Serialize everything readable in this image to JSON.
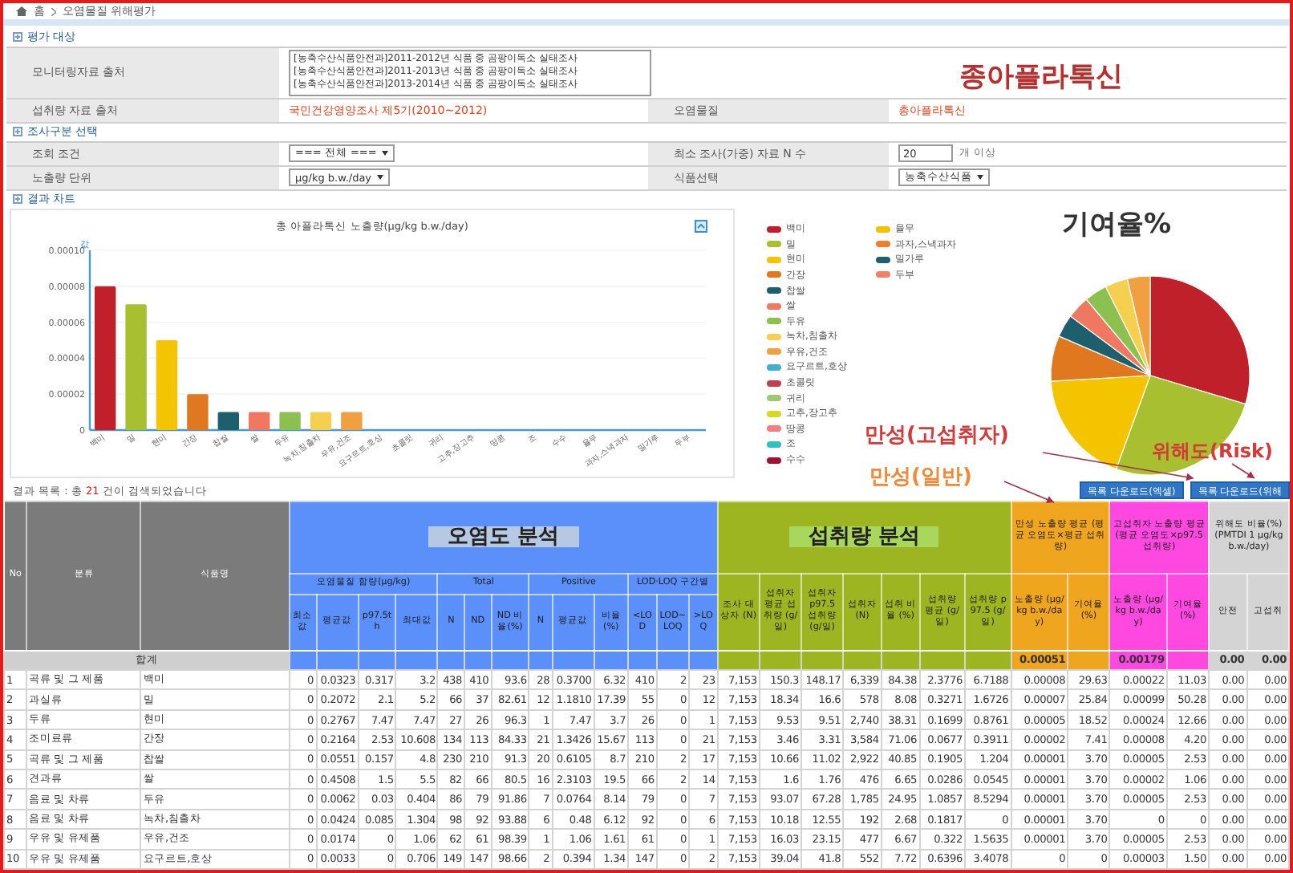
{
  "breadcrumb": {
    "items": [
      "홈",
      "오염물질 위해평가"
    ]
  },
  "evaluation_target": {
    "title": "평가 대상",
    "monitoring_source": {
      "label": "모니터링자료 출처",
      "options": [
        "[농축수산식품안전과]2011-2012년 식품 중 곰팡이독소 실태조사",
        "[농축수산식품안전과]2011-2013년 식품 중 곰팡이독소 실태조사",
        "[농축수산식품안전과]2013-2014년 식품 중 곰팡이독소 실태조사"
      ]
    },
    "intake_source": {
      "label": "섭취량 자료 출처",
      "value": "국민건강영양조사 제5기(2010~2012)"
    },
    "contaminant": {
      "label": "오염물질",
      "value": "총아플라톡신"
    }
  },
  "survey_filter": {
    "title": "조사구분 선택",
    "fields": [
      {
        "label": "조회 조건",
        "kind": "select",
        "value": "=== 전체 ==="
      },
      {
        "label": "최소 조사(가중) 자료 N 수",
        "kind": "number",
        "value": "20",
        "suffix": "개 이상"
      },
      {
        "label": "노출량 단위",
        "kind": "select",
        "value": "μg/kg b.w./day"
      },
      {
        "label": "식품선택",
        "kind": "select",
        "value": "농축수산식품"
      }
    ]
  },
  "results_chart": {
    "title": "결과 차트",
    "chart_data": {
      "type": "bar",
      "title": "총 아플라톡신 노출량(μg/kg b.w./day)",
      "ylabel": "값",
      "categories": [
        "백미",
        "밀",
        "현미",
        "간장",
        "찹쌀",
        "쌀",
        "두유",
        "녹차,침출차",
        "우유,건조",
        "요구르트,호상",
        "초콜릿",
        "귀리",
        "고추,장고추",
        "땅콩",
        "조",
        "수수",
        "율무",
        "과자,스낵과자",
        "밀가루",
        "두부"
      ],
      "values": [
        8e-05,
        7e-05,
        5e-05,
        2e-05,
        1e-05,
        1e-05,
        1e-05,
        1e-05,
        1e-05,
        0,
        0,
        0,
        0,
        0,
        0,
        0,
        0,
        0,
        0,
        0
      ],
      "grid": true,
      "ylim": [
        0,
        0.0001
      ],
      "yticks": [
        {
          "value": 0,
          "label": "0"
        },
        {
          "value": 2e-05,
          "label": "0.00002"
        },
        {
          "value": 4e-05,
          "label": "0.00004"
        },
        {
          "value": 6e-05,
          "label": "0.00006"
        },
        {
          "value": 8e-05,
          "label": "0.00008"
        },
        {
          "value": 0.0001,
          "label": "0.00010"
        }
      ]
    },
    "legend": [
      {
        "label": "백미",
        "color": "#c0202a"
      },
      {
        "label": "밀",
        "color": "#a8c030"
      },
      {
        "label": "현미",
        "color": "#f5c400"
      },
      {
        "label": "간장",
        "color": "#e07820"
      },
      {
        "label": "찹쌀",
        "color": "#1e5f6e"
      },
      {
        "label": "쌀",
        "color": "#f07860"
      },
      {
        "label": "두유",
        "color": "#8cc050"
      },
      {
        "label": "녹차,침출차",
        "color": "#f5d050"
      },
      {
        "label": "우유,건조",
        "color": "#f0a040"
      },
      {
        "label": "요구르트,호상",
        "color": "#40b0d0"
      },
      {
        "label": "초콜릿",
        "color": "#c04050"
      },
      {
        "label": "귀리",
        "color": "#a0c870"
      },
      {
        "label": "고추,장고추",
        "color": "#d8d820"
      },
      {
        "label": "땅콩",
        "color": "#f08080"
      },
      {
        "label": "조",
        "color": "#30c0c0"
      },
      {
        "label": "수수",
        "color": "#a01030"
      },
      {
        "label": "율무",
        "color": "#f2c200"
      },
      {
        "label": "과자,스낵과자",
        "color": "#e88030"
      },
      {
        "label": "밀가루",
        "color": "#1e6070"
      },
      {
        "label": "두부",
        "color": "#f08068"
      }
    ]
  },
  "annotations": {
    "contaminant_title": "종아플라톡신",
    "contribution_title": "기여율%",
    "chronic_high": "만성(고섭취자)",
    "chronic_general": "만성(일반)",
    "risk": "위해도(Risk)"
  },
  "results_list": {
    "prefix": "결과 목록 : 총",
    "count": "21",
    "suffix": "건이 검색되었습니다",
    "buttons": [
      "목록 다운로드(엑셀)",
      "목록 다운로드(위해"
    ]
  },
  "table": {
    "no": "No",
    "category": "분류",
    "food": "식품명",
    "total_label": "합계",
    "groups": [
      {
        "kind": "analysis",
        "title": "오염도 분석",
        "color": "#5b8ff9",
        "subgroups": [
          {
            "title": "오염물질 함량(μg/kg)",
            "columns": [
              "최소값",
              "평균값",
              "p97.5th",
              "최대값"
            ]
          },
          {
            "title": "Total",
            "columns": [
              "N",
              "ND",
              "ND 비율(%)"
            ]
          },
          {
            "title": "Positive",
            "columns": [
              "N",
              "평균값",
              "비율(%)"
            ]
          },
          {
            "title": "LOD·LOQ 구간별",
            "columns": [
              "<LOD",
              "LOD~LOQ",
              ">LOQ"
            ]
          }
        ]
      },
      {
        "kind": "analysis",
        "title": "섭취량 분석",
        "color": "#9cb520",
        "subgroups": [
          {
            "columns": [
              "조사 대상자 (N)",
              "섭취자 평균 섭취량 (g/일)",
              "섭취자 p97.5 섭취량 (g/일)",
              "섭취자 (N)",
              "섭취 비율 (%)",
              "섭취량 평균 (g/일)",
              "섭취량 p97.5 (g/일)"
            ]
          }
        ]
      },
      {
        "kind": "exposure",
        "title": "만성 노출량 평균 (평균 오염도×평균 섭취량)",
        "color": "#efa51d",
        "totals": [
          "0.00051"
        ],
        "subgroups": [
          {
            "columns": [
              "노출량 (μg/kg b.w./day)",
              "기여율 (%)"
            ]
          }
        ]
      },
      {
        "kind": "exposure",
        "title": "고섭취자 노출량 평균 (평균 오염도×p97.5 섭취량)",
        "color": "#ff48e0",
        "totals": [
          "0.00179"
        ],
        "subgroups": [
          {
            "columns": [
              "노출량 (μg/kg b.w./day)",
              "기여율 (%)"
            ]
          }
        ]
      },
      {
        "kind": "exposure",
        "title": "위해도 비율(%) (PMTDI 1 μg/kg b.w./day)",
        "color": "#d4d4d4",
        "totals": [
          "0.00",
          "0.00"
        ],
        "subgroups": [
          {
            "columns": [
              "안전",
              "고섭취"
            ]
          }
        ]
      }
    ],
    "rows": [
      {
        "no": "1",
        "category": "곡류 및 그 제품",
        "food": "백미",
        "cells": [
          "0",
          "0.0323",
          "0.317",
          "3.2",
          "438",
          "410",
          "93.6",
          "28",
          "0.3700",
          "6.32",
          "410",
          "2",
          "23",
          "7,153",
          "150.3",
          "148.17",
          "6,339",
          "84.38",
          "2.3776",
          "6.7188",
          "0.00008",
          "29.63",
          "0.00022",
          "11.03",
          "0.00",
          "0.00"
        ]
      },
      {
        "no": "2",
        "category": "과실류",
        "food": "밀",
        "cells": [
          "0",
          "0.2072",
          "2.1",
          "5.2",
          "66",
          "37",
          "82.61",
          "12",
          "1.1810",
          "17.39",
          "55",
          "0",
          "12",
          "7,153",
          "18.34",
          "16.6",
          "578",
          "8.08",
          "0.3271",
          "1.6726",
          "0.00007",
          "25.84",
          "0.00099",
          "50.28",
          "0.00",
          "0.00"
        ]
      },
      {
        "no": "3",
        "category": "두류",
        "food": "현미",
        "cells": [
          "0",
          "0.2767",
          "7.47",
          "7.47",
          "27",
          "26",
          "96.3",
          "1",
          "7.47",
          "3.7",
          "26",
          "0",
          "1",
          "7,153",
          "9.53",
          "9.51",
          "2,740",
          "38.31",
          "0.1699",
          "0.8761",
          "0.00005",
          "18.52",
          "0.00024",
          "12.66",
          "0.00",
          "0.00"
        ]
      },
      {
        "no": "4",
        "category": "조미료류",
        "food": "간장",
        "cells": [
          "0",
          "0.2164",
          "2.53",
          "10.608",
          "134",
          "113",
          "84.33",
          "21",
          "1.3426",
          "15.67",
          "113",
          "0",
          "21",
          "7,153",
          "3.46",
          "3.31",
          "3,584",
          "71.06",
          "0.0677",
          "0.3911",
          "0.00002",
          "7.41",
          "0.00008",
          "4.20",
          "0.00",
          "0.00"
        ]
      },
      {
        "no": "5",
        "category": "곡류 및 그 제품",
        "food": "찹쌀",
        "cells": [
          "0",
          "0.0551",
          "0.157",
          "4.8",
          "230",
          "210",
          "91.3",
          "20",
          "0.6105",
          "8.7",
          "210",
          "2",
          "17",
          "7,153",
          "10.66",
          "11.02",
          "2,922",
          "40.85",
          "0.1905",
          "1.204",
          "0.00001",
          "3.70",
          "0.00005",
          "2.53",
          "0.00",
          "0.00"
        ]
      },
      {
        "no": "6",
        "category": "견과류",
        "food": "쌀",
        "cells": [
          "0",
          "0.4508",
          "1.5",
          "5.5",
          "82",
          "66",
          "80.5",
          "16",
          "2.3103",
          "19.5",
          "66",
          "2",
          "14",
          "7,153",
          "1.6",
          "1.76",
          "476",
          "6.65",
          "0.0286",
          "0.0545",
          "0.00001",
          "3.70",
          "0.00002",
          "1.06",
          "0.00",
          "0.00"
        ]
      },
      {
        "no": "7",
        "category": "음료 및 차류",
        "food": "두유",
        "cells": [
          "0",
          "0.0062",
          "0.03",
          "0.404",
          "86",
          "79",
          "91.86",
          "7",
          "0.0764",
          "8.14",
          "79",
          "0",
          "7",
          "7,153",
          "93.07",
          "67.28",
          "1,785",
          "24.95",
          "1.0857",
          "8.5294",
          "0.00001",
          "3.70",
          "0.00005",
          "2.53",
          "0.00",
          "0.00"
        ]
      },
      {
        "no": "8",
        "category": "음료 및 차류",
        "food": "녹차,침출차",
        "cells": [
          "0",
          "0.0424",
          "0.085",
          "1.304",
          "98",
          "92",
          "93.88",
          "6",
          "0.48",
          "6.12",
          "92",
          "0",
          "6",
          "7,153",
          "10.18",
          "12.55",
          "192",
          "2.68",
          "0.1817",
          "0",
          "0.00001",
          "3.70",
          "0",
          "0",
          "0.00",
          "0.00"
        ]
      },
      {
        "no": "9",
        "category": "우유 및 유제품",
        "food": "우유,건조",
        "cells": [
          "0",
          "0.0174",
          "0",
          "1.06",
          "62",
          "61",
          "98.39",
          "1",
          "1.06",
          "1.61",
          "61",
          "0",
          "1",
          "7,153",
          "16.03",
          "23.15",
          "477",
          "6.67",
          "0.322",
          "1.5635",
          "0.00001",
          "3.70",
          "0.00005",
          "2.53",
          "0.00",
          "0.00"
        ]
      },
      {
        "no": "10",
        "category": "우유 및 유제품",
        "food": "요구르트,호상",
        "cells": [
          "0",
          "0.0033",
          "0",
          "0.706",
          "149",
          "147",
          "98.66",
          "2",
          "0.394",
          "1.34",
          "147",
          "0",
          "2",
          "7,153",
          "39.04",
          "41.8",
          "552",
          "7.72",
          "0.6396",
          "3.4078",
          "0",
          "0",
          "0.00003",
          "1.50",
          "0.00",
          "0.00"
        ]
      }
    ]
  }
}
